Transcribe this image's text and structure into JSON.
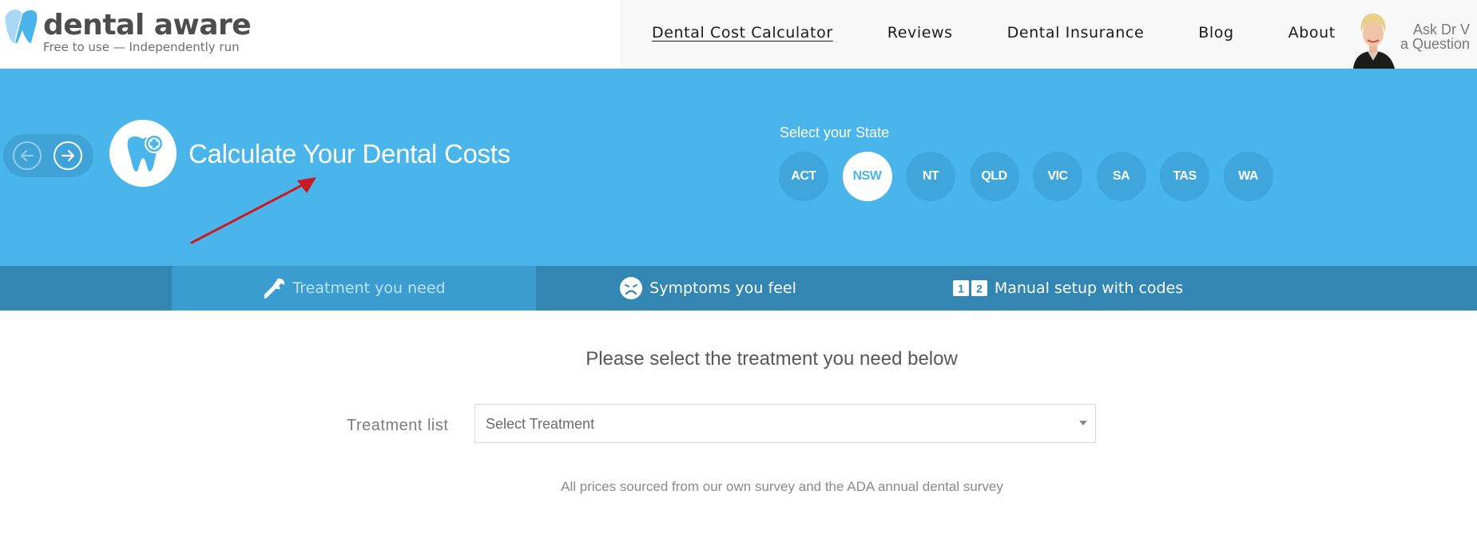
{
  "header": {
    "logo_name": "dental aware",
    "logo_tagline": "Free to use — Independently run",
    "nav": [
      {
        "label": "Dental Cost Calculator",
        "active": true
      },
      {
        "label": "Reviews",
        "active": false
      },
      {
        "label": "Dental Insurance",
        "active": false
      },
      {
        "label": "Blog",
        "active": false
      },
      {
        "label": "About",
        "active": false
      }
    ],
    "ask_line1": "Ask Dr V",
    "ask_line2": "a Question"
  },
  "hero": {
    "title": "Calculate Your Dental Costs",
    "state_label": "Select your State",
    "states": [
      "ACT",
      "NSW",
      "NT",
      "QLD",
      "VIC",
      "SA",
      "TAS",
      "WA"
    ],
    "selected_state": "NSW",
    "icons": {
      "prev": "arrow-left-circle-icon",
      "next": "arrow-right-circle-icon",
      "hero": "tooth-plus-icon",
      "annotation": "red-arrow-annotation"
    }
  },
  "tabs": [
    {
      "label": "Treatment you need",
      "icon": "wrench-icon",
      "active": true
    },
    {
      "label": "Symptoms you feel",
      "icon": "sad-face-icon",
      "active": false
    },
    {
      "label": "Manual setup with codes",
      "icon": "numbers-12-icon",
      "active": false
    }
  ],
  "content": {
    "title": "Please select the treatment you need below",
    "treatment_label": "Treatment list",
    "select_placeholder": "Select Treatment",
    "footnote": "All prices sourced from our own survey and the ADA annual dental survey"
  },
  "colors": {
    "hero_bg": "#4ab5ea",
    "tab_bar_bg": "#3386b1",
    "tab_active_bg": "#3a9ccf",
    "state_circle": "#3fa6dc",
    "annotation_arrow": "#cc1a22"
  }
}
